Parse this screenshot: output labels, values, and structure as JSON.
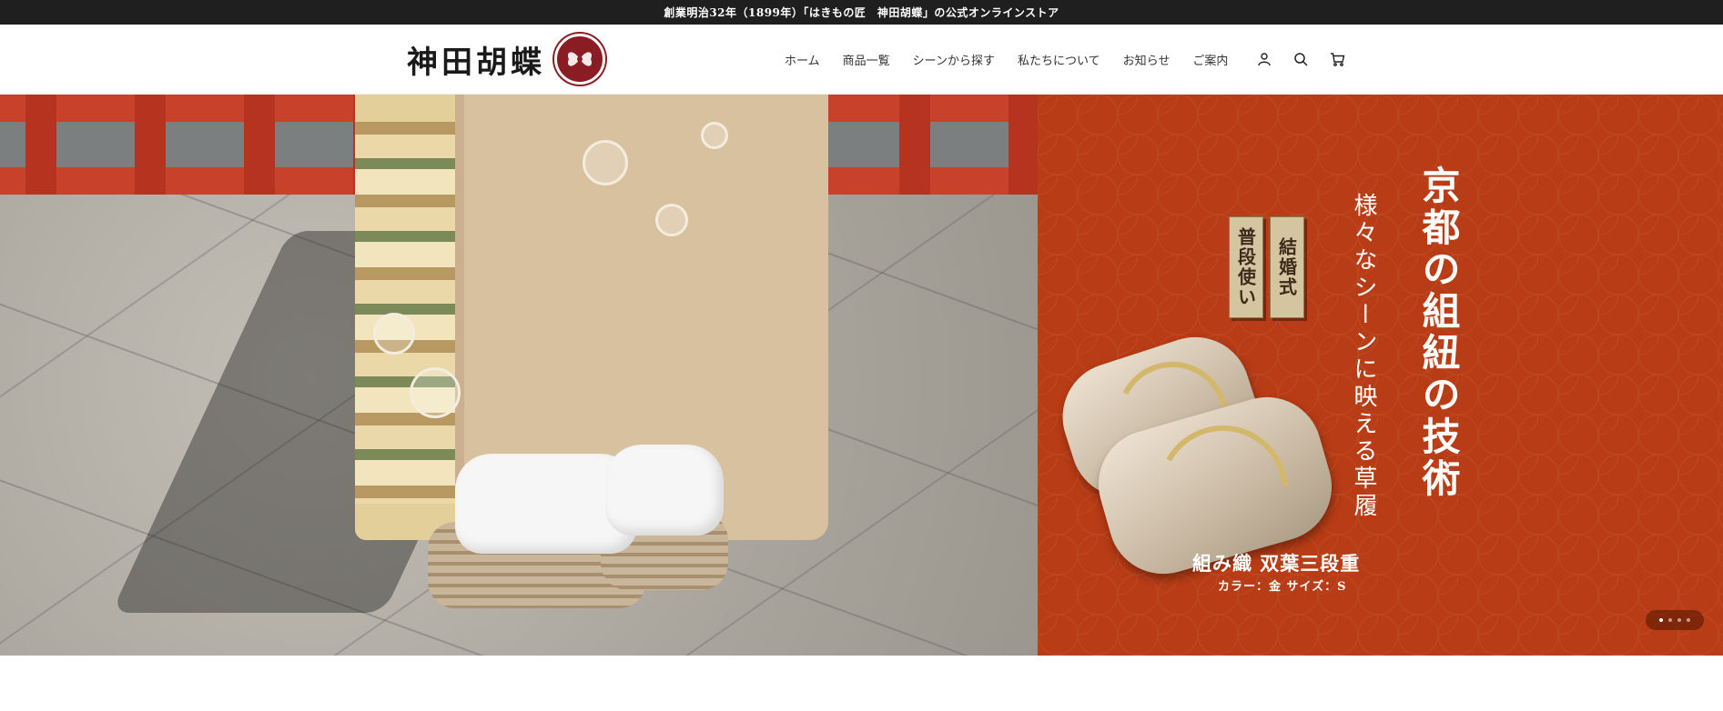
{
  "announcement": {
    "text": "創業明治32年（1899年）「はきもの匠　神田胡蝶」の公式オンラインストア"
  },
  "header": {
    "logo_text": "神田胡蝶",
    "nav": [
      {
        "label": "ホーム"
      },
      {
        "label": "商品一覧"
      },
      {
        "label": "シーンから探す"
      },
      {
        "label": "私たちについて"
      },
      {
        "label": "お知らせ"
      },
      {
        "label": "ご案内"
      }
    ],
    "icons": [
      "account-icon",
      "search-icon",
      "cart-icon"
    ]
  },
  "hero": {
    "headline": "京都の組紐の技術",
    "subheadline": "様々なシーンに映える草履",
    "tags": [
      "結婚式",
      "普段使い"
    ],
    "product_name": "組み織 双葉三段重",
    "product_spec": "カラー：金 サイズ：S",
    "accent_color": "#b83c15",
    "slides": 4,
    "active_slide": 1
  }
}
